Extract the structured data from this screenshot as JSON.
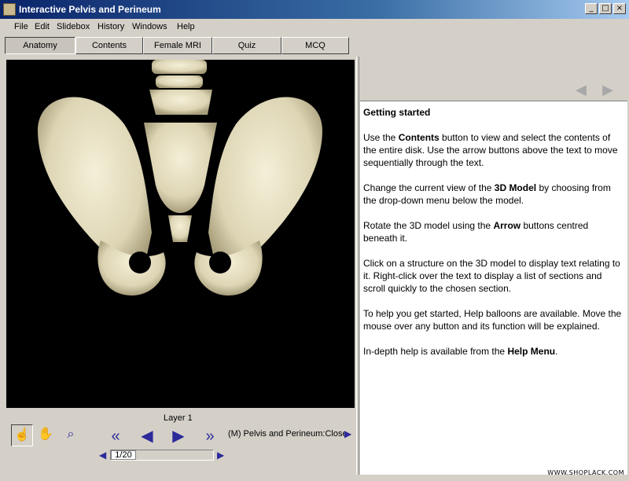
{
  "window": {
    "title": "Interactive Pelvis and Perineum",
    "buttons": [
      "_",
      "□",
      "×"
    ]
  },
  "menu": [
    "File",
    "Edit",
    "Slidebox",
    "History",
    "Windows",
    "Help"
  ],
  "tabs": [
    "Anatomy",
    "Contents",
    "Female MRI",
    "Quiz",
    "MCQ"
  ],
  "active_tab": "Anatomy",
  "viewer": {
    "layer_label": "Layer 1",
    "view_selection": "(M) Pelvis and Perineum:Close",
    "slider_value": "1/20",
    "tools": [
      "pointer-hand-icon",
      "grab-hand-icon",
      "magnifier-icon"
    ]
  },
  "help_text": {
    "heading": "Getting started",
    "p1": [
      "Use the ",
      "Contents",
      " button to view and select the contents of the entire disk.  Use the arrow buttons above the text to move sequentially through the text."
    ],
    "p2": [
      "Change the current view of the ",
      "3D Model",
      " by choosing from the drop-down menu below the model."
    ],
    "p3": [
      "Rotate the 3D model using the ",
      "Arrow",
      " buttons centred beneath it."
    ],
    "p4": [
      "Click on a structure on the 3D model to display text relating to it. ",
      "Right-click over the text to display a list of sections and scroll quickly to the chosen section.",
      ""
    ],
    "p5": "To help you get started, Help balloons are available. Move the mouse over any button and its function will be explained.",
    "p6": [
      "In-depth help is available from the ",
      "Help Menu",
      "."
    ]
  },
  "watermark": "WWW.SHOPLACK.COM",
  "colors": {
    "accent_blue": "#2d2a9a",
    "titlebar": "#0a246a",
    "bone": "#ece6cc"
  }
}
